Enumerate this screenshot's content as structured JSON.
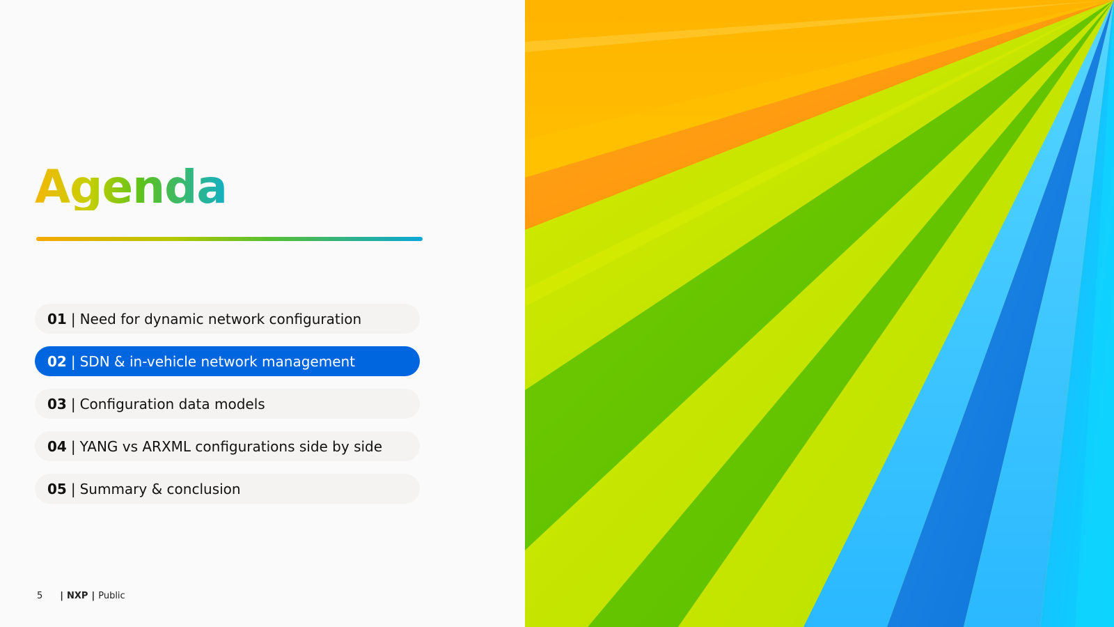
{
  "slide": {
    "title": "Agenda",
    "items": [
      {
        "number": "01",
        "separator": "|",
        "label": "Need for dynamic network configuration",
        "active": false
      },
      {
        "number": "02",
        "separator": "|",
        "label": "SDN & in-vehicle network management",
        "active": true
      },
      {
        "number": "03",
        "separator": "|",
        "label": "Configuration data models",
        "active": false
      },
      {
        "number": "04",
        "separator": "|",
        "label": "YANG vs ARXML configurations side by side",
        "active": false
      },
      {
        "number": "05",
        "separator": "|",
        "label": "Summary & conclusion",
        "active": false
      }
    ]
  },
  "footer": {
    "page_number": "5",
    "bar": "|",
    "brand": "NXP",
    "classification": "Public"
  },
  "colors": {
    "active_item": "#0066e0",
    "item_background": "#f4f3f1",
    "title_gradient": [
      "#f2b705",
      "#c8cf00",
      "#5fc21b",
      "#12afc6"
    ]
  },
  "decorative_art": {
    "description_icon": "ray-burst-graphic",
    "ray_colors": [
      "#ffb300",
      "#ffd000",
      "#ff9a1a",
      "#c8e600",
      "#5fc000",
      "#b6e000",
      "#3cc8ff",
      "#1a8ee6",
      "#0ec8ff"
    ]
  }
}
